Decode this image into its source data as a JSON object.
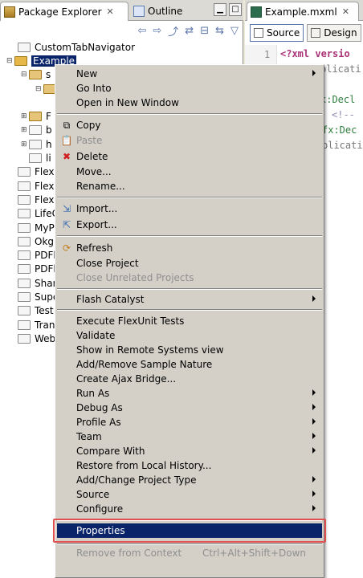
{
  "left_tabs": {
    "package_explorer": "Package Explorer",
    "outline": "Outline"
  },
  "tree": [
    {
      "label": "CustomTabNavigator"
    },
    {
      "label": "Example"
    },
    {
      "label": "s"
    },
    {
      "label": ""
    },
    {
      "label": ""
    },
    {
      "label": "F"
    },
    {
      "label": "b"
    },
    {
      "label": "h"
    },
    {
      "label": "li"
    },
    {
      "label": "Flex"
    },
    {
      "label": "Flex"
    },
    {
      "label": "Flex"
    },
    {
      "label": "LifeC"
    },
    {
      "label": "MyP"
    },
    {
      "label": "Okg"
    },
    {
      "label": "PDFl"
    },
    {
      "label": "PDFl"
    },
    {
      "label": "Shar"
    },
    {
      "label": "Supe"
    },
    {
      "label": "Test"
    },
    {
      "label": "Tran"
    },
    {
      "label": "Web"
    }
  ],
  "editor": {
    "tab_title": "Example.mxml",
    "source_label": "Source",
    "design_label": "Design",
    "line_number": "1",
    "code_lines": [
      "<?xml versio",
      "plicati",
      "",
      "x:Decl",
      "<!--",
      "fx:Dec",
      "plicati"
    ]
  },
  "menu": {
    "new": "New",
    "go_into": "Go Into",
    "open_new_window": "Open in New Window",
    "copy": "Copy",
    "paste": "Paste",
    "delete": "Delete",
    "move": "Move...",
    "rename": "Rename...",
    "import": "Import...",
    "export": "Export...",
    "refresh": "Refresh",
    "close_project": "Close Project",
    "close_unrelated": "Close Unrelated Projects",
    "flash_catalyst": "Flash Catalyst",
    "execute_flexunit": "Execute FlexUnit Tests",
    "validate": "Validate",
    "show_remote": "Show in Remote Systems view",
    "add_remove_sample": "Add/Remove Sample Nature",
    "create_ajax": "Create Ajax Bridge...",
    "run_as": "Run As",
    "debug_as": "Debug As",
    "profile_as": "Profile As",
    "team": "Team",
    "compare_with": "Compare With",
    "restore_history": "Restore from Local History...",
    "add_change_type": "Add/Change Project Type",
    "source": "Source",
    "configure": "Configure",
    "properties": "Properties",
    "remove_context": "Remove from Context",
    "remove_context_accel": "Ctrl+Alt+Shift+Down"
  },
  "colors": {
    "selection": "#0a246a",
    "highlight_outline": "#e05050",
    "menu_bg": "#d4d0c8"
  }
}
